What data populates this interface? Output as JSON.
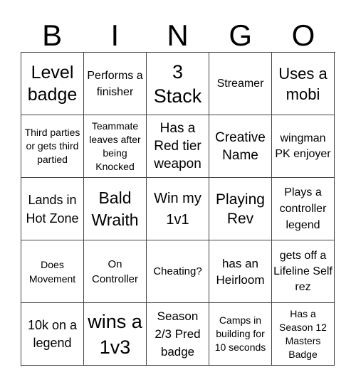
{
  "header": {
    "letters": [
      "B",
      "I",
      "N",
      "G",
      "O"
    ]
  },
  "board": {
    "cells": [
      [
        "Level badge",
        "Performs a finisher",
        "3 Stack",
        "Streamer",
        "Uses a mobi"
      ],
      [
        "Third parties or gets third partied",
        "Teammate leaves after being Knocked",
        "Has a Red tier weapon",
        "Creative Name",
        "wingman PK enjoyer"
      ],
      [
        "Lands in Hot Zone",
        "Bald Wraith",
        "Win my 1v1",
        "Playing Rev",
        "Plays a controller legend"
      ],
      [
        "Does Movement",
        "On Controller",
        "Cheating?",
        "has an Heirloom",
        "gets off a Lifeline Self rez"
      ],
      [
        "10k on a legend",
        "wins a 1v3",
        "Season 2/3 Pred badge",
        "Camps in building for 10 seconds",
        "Has a Season 12 Masters Badge"
      ]
    ]
  }
}
